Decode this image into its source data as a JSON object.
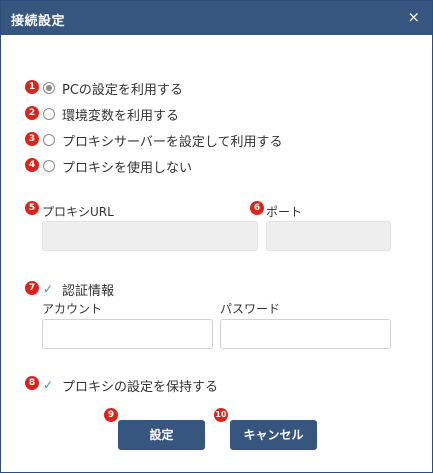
{
  "window": {
    "title": "接続設定",
    "close_label": "×"
  },
  "proxy_options": [
    {
      "marker": "1",
      "label": "PCの設定を利用する",
      "selected": true
    },
    {
      "marker": "2",
      "label": "環境変数を利用する",
      "selected": false
    },
    {
      "marker": "3",
      "label": "プロキシサーバーを設定して利用する",
      "selected": false
    },
    {
      "marker": "4",
      "label": "プロキシを使用しない",
      "selected": false
    }
  ],
  "proxy_url": {
    "marker": "5",
    "label": "プロキシURL",
    "value": ""
  },
  "port": {
    "marker": "6",
    "label": "ポート",
    "value": ""
  },
  "auth": {
    "marker": "7",
    "label": "認証情報",
    "checked": true,
    "account_label": "アカウント",
    "account_value": "",
    "password_label": "パスワード",
    "password_value": ""
  },
  "keep_proxy": {
    "marker": "8",
    "label": "プロキシの設定を保持する",
    "checked": true
  },
  "buttons": {
    "ok_marker": "9",
    "ok_label": "設定",
    "cancel_marker": "10",
    "cancel_label": "キャンセル"
  },
  "colors": {
    "titlebar": "#36557f",
    "marker": "#d9261c",
    "check": "#4a88c8"
  }
}
